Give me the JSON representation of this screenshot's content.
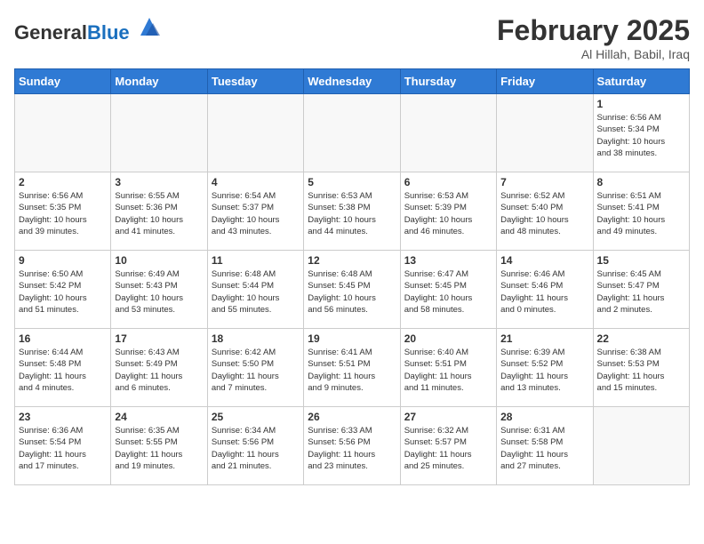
{
  "logo": {
    "general": "General",
    "blue": "Blue"
  },
  "title": "February 2025",
  "location": "Al Hillah, Babil, Iraq",
  "days_header": [
    "Sunday",
    "Monday",
    "Tuesday",
    "Wednesday",
    "Thursday",
    "Friday",
    "Saturday"
  ],
  "weeks": [
    [
      {
        "day": "",
        "info": ""
      },
      {
        "day": "",
        "info": ""
      },
      {
        "day": "",
        "info": ""
      },
      {
        "day": "",
        "info": ""
      },
      {
        "day": "",
        "info": ""
      },
      {
        "day": "",
        "info": ""
      },
      {
        "day": "1",
        "info": "Sunrise: 6:56 AM\nSunset: 5:34 PM\nDaylight: 10 hours\nand 38 minutes."
      }
    ],
    [
      {
        "day": "2",
        "info": "Sunrise: 6:56 AM\nSunset: 5:35 PM\nDaylight: 10 hours\nand 39 minutes."
      },
      {
        "day": "3",
        "info": "Sunrise: 6:55 AM\nSunset: 5:36 PM\nDaylight: 10 hours\nand 41 minutes."
      },
      {
        "day": "4",
        "info": "Sunrise: 6:54 AM\nSunset: 5:37 PM\nDaylight: 10 hours\nand 43 minutes."
      },
      {
        "day": "5",
        "info": "Sunrise: 6:53 AM\nSunset: 5:38 PM\nDaylight: 10 hours\nand 44 minutes."
      },
      {
        "day": "6",
        "info": "Sunrise: 6:53 AM\nSunset: 5:39 PM\nDaylight: 10 hours\nand 46 minutes."
      },
      {
        "day": "7",
        "info": "Sunrise: 6:52 AM\nSunset: 5:40 PM\nDaylight: 10 hours\nand 48 minutes."
      },
      {
        "day": "8",
        "info": "Sunrise: 6:51 AM\nSunset: 5:41 PM\nDaylight: 10 hours\nand 49 minutes."
      }
    ],
    [
      {
        "day": "9",
        "info": "Sunrise: 6:50 AM\nSunset: 5:42 PM\nDaylight: 10 hours\nand 51 minutes."
      },
      {
        "day": "10",
        "info": "Sunrise: 6:49 AM\nSunset: 5:43 PM\nDaylight: 10 hours\nand 53 minutes."
      },
      {
        "day": "11",
        "info": "Sunrise: 6:48 AM\nSunset: 5:44 PM\nDaylight: 10 hours\nand 55 minutes."
      },
      {
        "day": "12",
        "info": "Sunrise: 6:48 AM\nSunset: 5:45 PM\nDaylight: 10 hours\nand 56 minutes."
      },
      {
        "day": "13",
        "info": "Sunrise: 6:47 AM\nSunset: 5:45 PM\nDaylight: 10 hours\nand 58 minutes."
      },
      {
        "day": "14",
        "info": "Sunrise: 6:46 AM\nSunset: 5:46 PM\nDaylight: 11 hours\nand 0 minutes."
      },
      {
        "day": "15",
        "info": "Sunrise: 6:45 AM\nSunset: 5:47 PM\nDaylight: 11 hours\nand 2 minutes."
      }
    ],
    [
      {
        "day": "16",
        "info": "Sunrise: 6:44 AM\nSunset: 5:48 PM\nDaylight: 11 hours\nand 4 minutes."
      },
      {
        "day": "17",
        "info": "Sunrise: 6:43 AM\nSunset: 5:49 PM\nDaylight: 11 hours\nand 6 minutes."
      },
      {
        "day": "18",
        "info": "Sunrise: 6:42 AM\nSunset: 5:50 PM\nDaylight: 11 hours\nand 7 minutes."
      },
      {
        "day": "19",
        "info": "Sunrise: 6:41 AM\nSunset: 5:51 PM\nDaylight: 11 hours\nand 9 minutes."
      },
      {
        "day": "20",
        "info": "Sunrise: 6:40 AM\nSunset: 5:51 PM\nDaylight: 11 hours\nand 11 minutes."
      },
      {
        "day": "21",
        "info": "Sunrise: 6:39 AM\nSunset: 5:52 PM\nDaylight: 11 hours\nand 13 minutes."
      },
      {
        "day": "22",
        "info": "Sunrise: 6:38 AM\nSunset: 5:53 PM\nDaylight: 11 hours\nand 15 minutes."
      }
    ],
    [
      {
        "day": "23",
        "info": "Sunrise: 6:36 AM\nSunset: 5:54 PM\nDaylight: 11 hours\nand 17 minutes."
      },
      {
        "day": "24",
        "info": "Sunrise: 6:35 AM\nSunset: 5:55 PM\nDaylight: 11 hours\nand 19 minutes."
      },
      {
        "day": "25",
        "info": "Sunrise: 6:34 AM\nSunset: 5:56 PM\nDaylight: 11 hours\nand 21 minutes."
      },
      {
        "day": "26",
        "info": "Sunrise: 6:33 AM\nSunset: 5:56 PM\nDaylight: 11 hours\nand 23 minutes."
      },
      {
        "day": "27",
        "info": "Sunrise: 6:32 AM\nSunset: 5:57 PM\nDaylight: 11 hours\nand 25 minutes."
      },
      {
        "day": "28",
        "info": "Sunrise: 6:31 AM\nSunset: 5:58 PM\nDaylight: 11 hours\nand 27 minutes."
      },
      {
        "day": "",
        "info": ""
      }
    ]
  ]
}
